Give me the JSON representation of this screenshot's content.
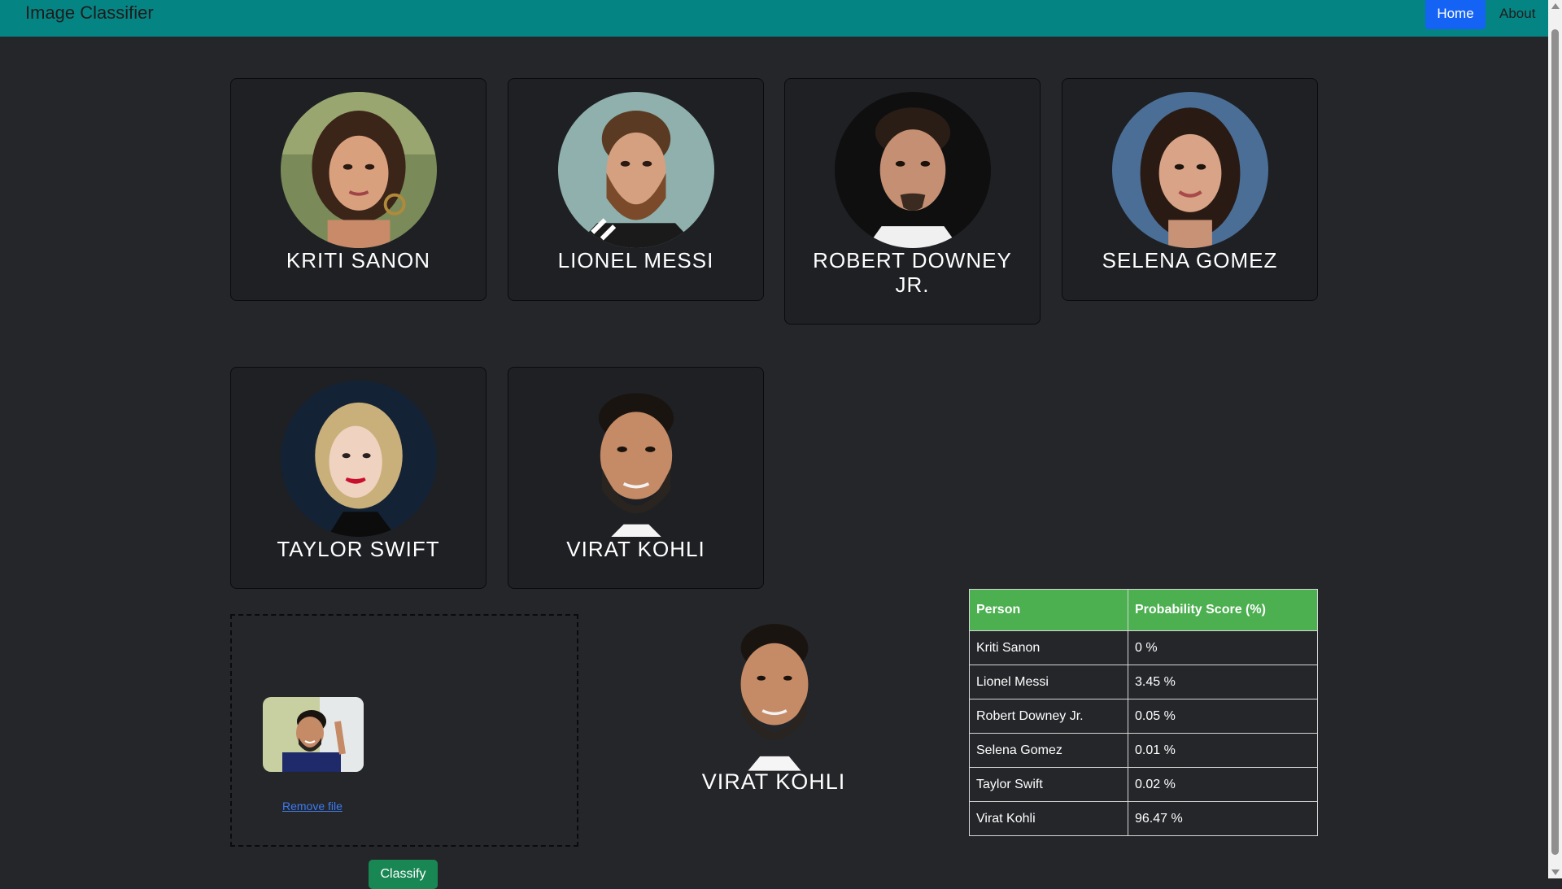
{
  "navbar": {
    "brand": "Image Classifier",
    "home_label": "Home",
    "about_label": "About"
  },
  "celebrities": [
    {
      "name": "KRITI SANON",
      "icon": "portrait-kriti-sanon"
    },
    {
      "name": "LIONEL MESSI",
      "icon": "portrait-lionel-messi"
    },
    {
      "name": "ROBERT DOWNEY JR.",
      "icon": "portrait-robert-downey-jr"
    },
    {
      "name": "SELENA GOMEZ",
      "icon": "portrait-selena-gomez"
    },
    {
      "name": "TAYLOR SWIFT",
      "icon": "portrait-taylor-swift"
    },
    {
      "name": "VIRAT KOHLI",
      "icon": "portrait-virat-kohli"
    }
  ],
  "upload": {
    "remove_label": "Remove file",
    "classify_label": "Classify"
  },
  "result": {
    "name": "VIRAT KOHLI"
  },
  "scores": {
    "headers": [
      "Person",
      "Probability Score (%)"
    ],
    "rows": [
      {
        "person": "Kriti Sanon",
        "score": "0 %"
      },
      {
        "person": "Lionel Messi",
        "score": "3.45 %"
      },
      {
        "person": "Robert Downey Jr.",
        "score": "0.05 %"
      },
      {
        "person": "Selena Gomez",
        "score": "0.01 %"
      },
      {
        "person": "Taylor Swift",
        "score": "0.02 %"
      },
      {
        "person": "Virat Kohli",
        "score": "96.47 %"
      }
    ]
  },
  "colors": {
    "navbar": "#058484",
    "accent": "#1463f5",
    "table_header": "#4caf50",
    "classify_button": "#198754",
    "background": "#24262a"
  }
}
